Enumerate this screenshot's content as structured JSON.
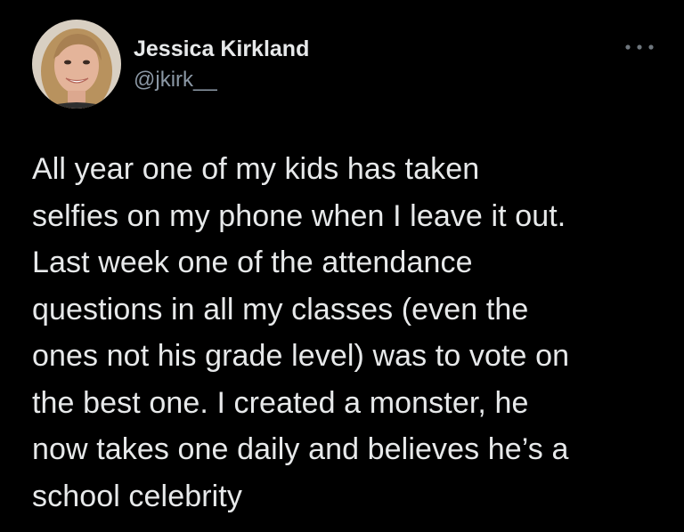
{
  "tweet": {
    "author": {
      "display_name": "Jessica Kirkland",
      "handle": "@jkirk__"
    },
    "more_icon": "more-horizontal-icon",
    "text": "All year one of my kids has taken\nselfies on my phone when I leave it out.\nLast week one of the attendance\nquestions in all my classes (even the\nones not his grade level) was to vote on\nthe best one. I created a monster, he\nnow takes one daily and believes he’s a\nschool celebrity"
  },
  "colors": {
    "background": "#000000",
    "text_primary": "#e7e9ea",
    "text_secondary": "#8b98a5"
  }
}
